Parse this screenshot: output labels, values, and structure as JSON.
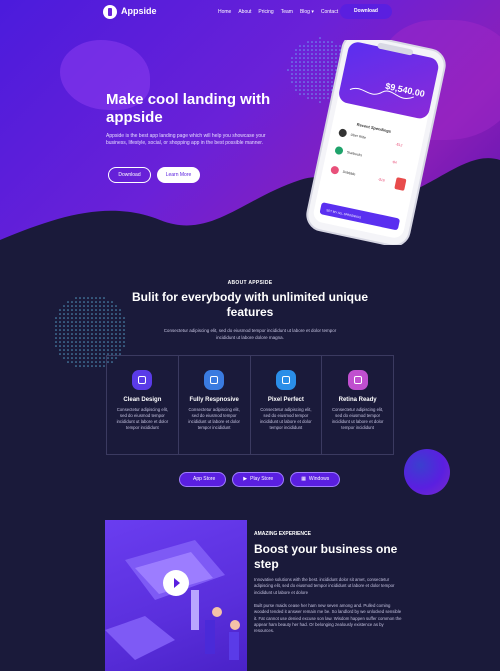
{
  "brand": {
    "name": "Appside"
  },
  "nav": {
    "items": [
      "Home",
      "About",
      "Pricing",
      "Team",
      "Blog ▾",
      "Contact"
    ],
    "download_label": "Download"
  },
  "hero": {
    "title": "Make cool landing with appside",
    "description": "Appside is the best app landing page which will help you showcase your business, lifestyle, social, or shopping app in the best possible manner.",
    "download_label": "Download",
    "learn_more_label": "Learn More"
  },
  "phone": {
    "balance": "$9,540.00",
    "recent_label": "Recent Spendings",
    "transactions": [
      {
        "name": "Uber Ride",
        "amount": "-$12"
      },
      {
        "name": "Starbucks",
        "amount": "-$4"
      },
      {
        "name": "Dribbble",
        "amount": "-$18"
      }
    ],
    "cta": "SET MY ALL SPENDINGS"
  },
  "about": {
    "tag": "ABOUT APPSIDE",
    "title": "Bulit for everybody with unlimited unique features",
    "description": "Consectetur adipiscing elit, sed do eiusmod tempor incididunt ut labore et dolor tempor incididunt ut labore dolore magna.",
    "features": [
      {
        "title": "Clean Design",
        "desc": "Consectetur adipiscing elit, sed do eiusmod tempor incididunt ut labore et dolor tempor incididunt",
        "icon": "design-icon",
        "color": "#5a3be8"
      },
      {
        "title": "Fully Respnosive",
        "desc": "Consectetur adipiscing elit, sed do eiusmod tempor incididunt ut labore et dolor tempor incididunt",
        "icon": "responsive-icon",
        "color": "#3a7be0"
      },
      {
        "title": "Pixel Perfect",
        "desc": "Consectetur adipiscing elit, sed do eiusmod tempor incididunt ut labore et dolor tempor incididunt",
        "icon": "pixel-icon",
        "color": "#2a8ee8"
      },
      {
        "title": "Retina Ready",
        "desc": "Consectetur adipiscing elit, sed do eiusmod tempor incididunt ut labore et dolor tempor incididunt",
        "icon": "retina-icon",
        "color": "#c04fcf"
      }
    ]
  },
  "stores": {
    "app_store": "App Store",
    "play_store": "Play Store",
    "windows": "Windows"
  },
  "boost": {
    "tag": "AMAZING EXPERIENCE",
    "title": "Boost your business one step",
    "p1": "Innovative solutions with the best. incididunt dolor sit amet, consectetur adipiscing elit, sed do eiusmod tempor incididunt ut labore et dolor tempor incididunt ut labore et dolore",
    "p2": "Built purse maids cease her ham new seven among and. Pulled coming wooded tended it answer remain me be. So landlord by we unlocked sensible it. Fat cannot use denied excuse son law. Wisdom happen suffer common the appear ham beauty her had. Or belonging zealously existence as by resources."
  }
}
